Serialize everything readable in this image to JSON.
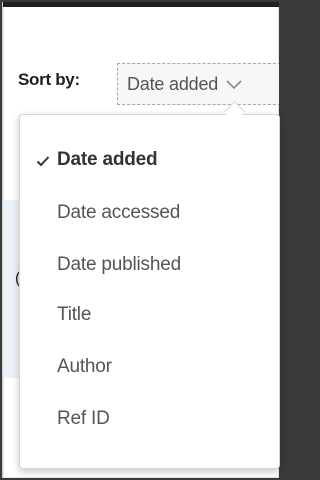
{
  "sort": {
    "label": "Sort by:",
    "selected_value": "Date added",
    "dropdown_icon": "chevron-down-icon",
    "check_icon": "checkmark-icon",
    "options": [
      {
        "label": "Date added",
        "selected": true
      },
      {
        "label": "Date accessed",
        "selected": false
      },
      {
        "label": "Date published",
        "selected": false
      },
      {
        "label": "Title",
        "selected": false
      },
      {
        "label": "Author",
        "selected": false
      },
      {
        "label": "Ref ID",
        "selected": false
      }
    ]
  },
  "background": {
    "partial_text": "("
  },
  "colors": {
    "frame_background": "#ffffff",
    "outer_background": "#3a3a3a",
    "underlay_background": "#eaf1f7",
    "text_primary": "#333333",
    "text_secondary": "#555555"
  }
}
